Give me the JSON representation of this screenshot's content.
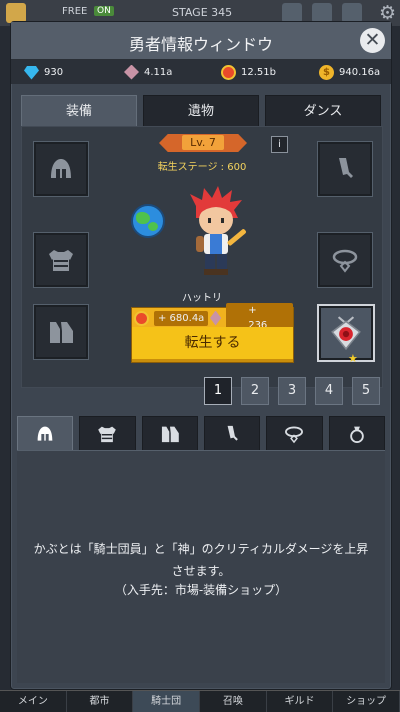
{
  "background": {
    "free_label": "FREE",
    "on_label": "ON",
    "stage_label": "STAGE 345"
  },
  "window": {
    "title": "勇者情報ウィンドウ",
    "close_icon": "close-icon"
  },
  "currencies": [
    {
      "icon": "diamond-icon",
      "value": "930"
    },
    {
      "icon": "crystal-icon",
      "value": "4.11a"
    },
    {
      "icon": "medal-icon",
      "value": "12.51b"
    },
    {
      "icon": "gold-coin-icon",
      "value": "940.16a"
    }
  ],
  "tabs": [
    {
      "label": "装備",
      "active": true
    },
    {
      "label": "遺物",
      "active": false
    },
    {
      "label": "ダンス",
      "active": false
    }
  ],
  "hero": {
    "level": "Lv. 7",
    "rebirth_stage": "転生ステージ : 600",
    "name": "ハットリ",
    "info_label": "i"
  },
  "rebirth": {
    "cost_medals": "+ 680.4a",
    "cost_crystals": "+ 236",
    "button_label": "転生する"
  },
  "equipment_slots": {
    "left": [
      "helmet-icon",
      "armor-icon",
      "boots-icon"
    ],
    "right": [
      "sword-icon",
      "necklace-icon",
      "rose-pendant-icon"
    ]
  },
  "pagination": {
    "pages": [
      "1",
      "2",
      "3",
      "4",
      "5"
    ],
    "current": "1"
  },
  "category_tabs": [
    "helmet-icon",
    "armor-icon",
    "boots-icon",
    "sword-icon",
    "necklace-icon",
    "ring-icon"
  ],
  "description": {
    "line1": "かぶとは「騎士団員」と「神」のクリティカルダメージを上昇",
    "line2": "させます。",
    "line3": "（入手先：市場-装備ショップ）"
  },
  "bottom_nav": [
    "メイン",
    "都市",
    "騎士団",
    "召喚",
    "ギルド",
    "ショップ"
  ],
  "colors": {
    "window_bg": "#3d4550",
    "header_bg": "#555e6a",
    "accent_gold": "#f5c218",
    "rebirth_text": "#f4d35e",
    "level_ribbon": "#d5662a"
  }
}
